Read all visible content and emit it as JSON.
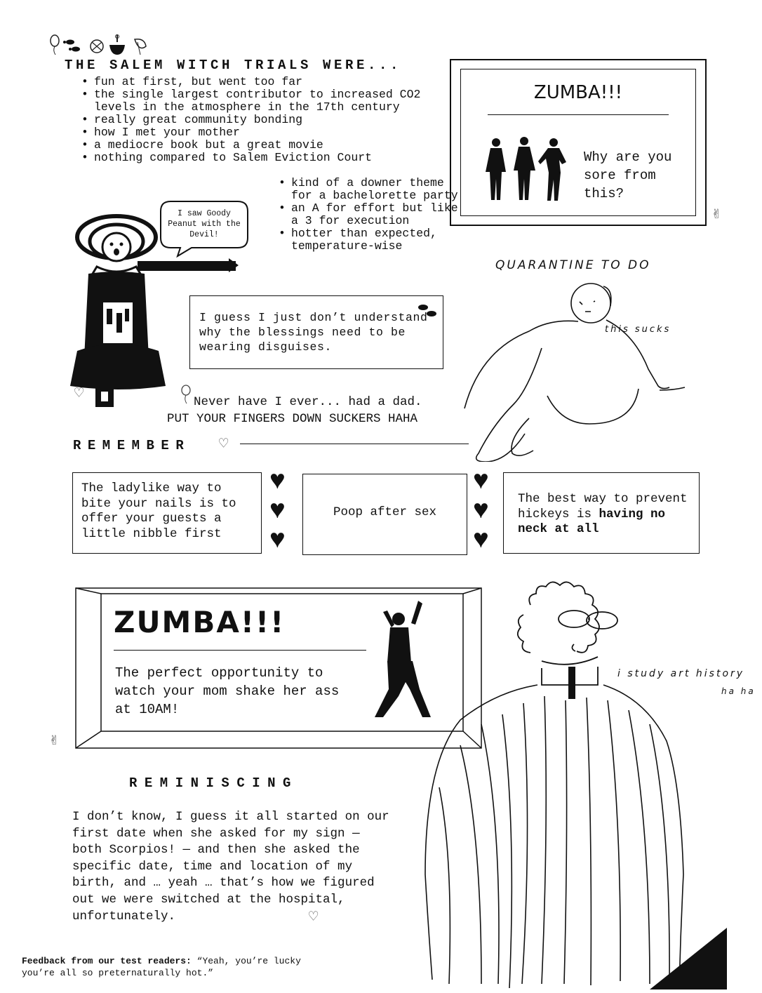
{
  "header_icons": [
    "balloon-icon",
    "footprints-icon",
    "biohazard-icon",
    "cauldron-icon",
    "leaf-icon"
  ],
  "salem": {
    "title": "THE SALEM WITCH TRIALS WERE...",
    "list_a": [
      "fun at first, but went too far",
      "the single largest contributor to increased CO2 levels in the atmosphere in the 17th century",
      "really great community bonding",
      "how I met your mother",
      "a mediocre book but a great movie",
      "nothing compared to Salem Eviction Court"
    ],
    "list_b": [
      "kind of a downer theme for a bachelorette party",
      "an A for effort but like a 3 for execution",
      "hotter than expected, temperature-wise"
    ],
    "speech": "I saw Goody Peanut with the Devil!"
  },
  "zumba_top": {
    "title": "ZUMBA!!!",
    "text": "Why are you sore from this?"
  },
  "quarantine": {
    "label": "QUARANTINE TO DO",
    "note": "this sucks"
  },
  "blessings": {
    "text": "I guess I just don’t understand why the blessings need to be wearing disguises."
  },
  "never": {
    "line1": "Never have I ever... had a dad.",
    "line2": "PUT YOUR FINGERS DOWN SUCKERS HAHA"
  },
  "remember": {
    "heading": "REMEMBER",
    "box1": "The ladylike way to bite your nails is to offer your guests a little nibble first",
    "box2": "Poop after sex",
    "box3_a": "The best way to prevent hickeys is",
    "box3_b": "having no neck at all"
  },
  "zumba_bottom": {
    "title": "ZUMBA!!!",
    "text": "The perfect opportunity to watch your mom shake her ass at 10AM!"
  },
  "art_history": {
    "line1": "i study art history",
    "line2": "ha ha"
  },
  "reminiscing": {
    "heading": "REMINISCING",
    "text": "I don’t know, I guess it all started on our first date when she asked for my sign — both Scorpios! — and then she asked the specific date, time and location of my birth, and … yeah … that’s how we figured out we were switched at the hospital, unfortunately."
  },
  "feedback": {
    "label": "Feedback from our test readers:",
    "quote": "“Yeah, you’re lucky you’re all so preternaturally hot.”"
  }
}
